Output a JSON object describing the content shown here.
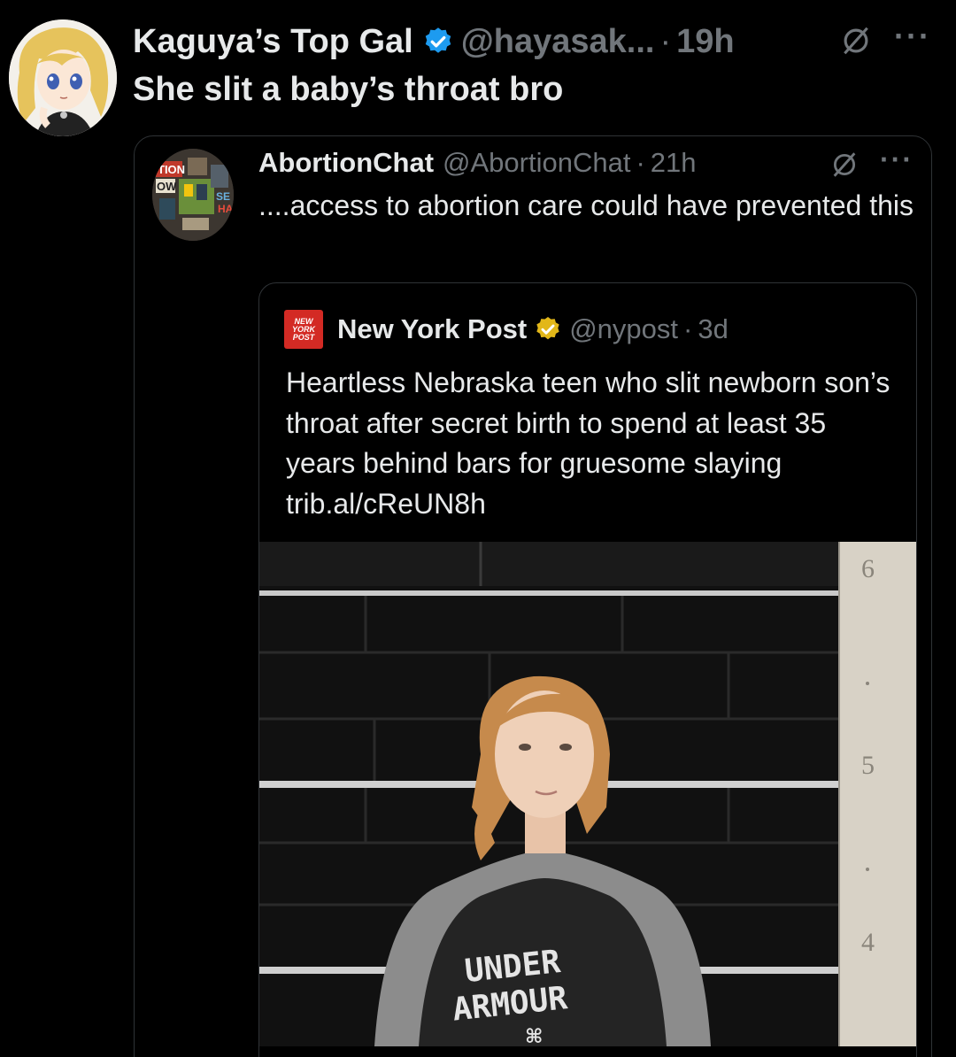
{
  "colors": {
    "background": "#000000",
    "text_primary": "#e7e9ea",
    "text_secondary": "#71767b",
    "verified_blue": "#1d9bf0",
    "verified_gold": "#e2b719",
    "border": "#2f3336",
    "nypost_red": "#d32a24"
  },
  "post": {
    "author_name": "Kaguya’s Top Gal",
    "handle": "@hayasak...",
    "separator": "·",
    "time": "19h",
    "more": "···",
    "text": "She slit a baby’s throat bro",
    "avatar_icon": "anime-avatar",
    "verified_icon": "verified-blue-badge",
    "grok_icon": "grok-icon"
  },
  "quote": {
    "author_name": "AbortionChat",
    "handle": "@AbortionChat",
    "separator": "·",
    "time": "21h",
    "more": "···",
    "text": "....access to abortion care could have prevented this",
    "avatar_icon": "bookstore-avatar",
    "grok_icon": "grok-icon"
  },
  "nested_quote": {
    "author_name": "New York Post",
    "handle": "@nypost",
    "separator": "·",
    "time": "3d",
    "text": "Heartless Nebraska teen who slit newborn son’s throat after secret birth to spend at least 35 years behind bars for gruesome slaying trib.al/cReUN8h",
    "logo_lines": [
      "NEW",
      "YORK",
      "POST"
    ],
    "verified_icon": "verified-gold-badge",
    "photo": {
      "icon": "mugshot-photo",
      "height_marks": [
        "6",
        "5",
        "4"
      ],
      "shirt_lines": [
        "UNDER",
        "ARMOUR"
      ]
    }
  }
}
